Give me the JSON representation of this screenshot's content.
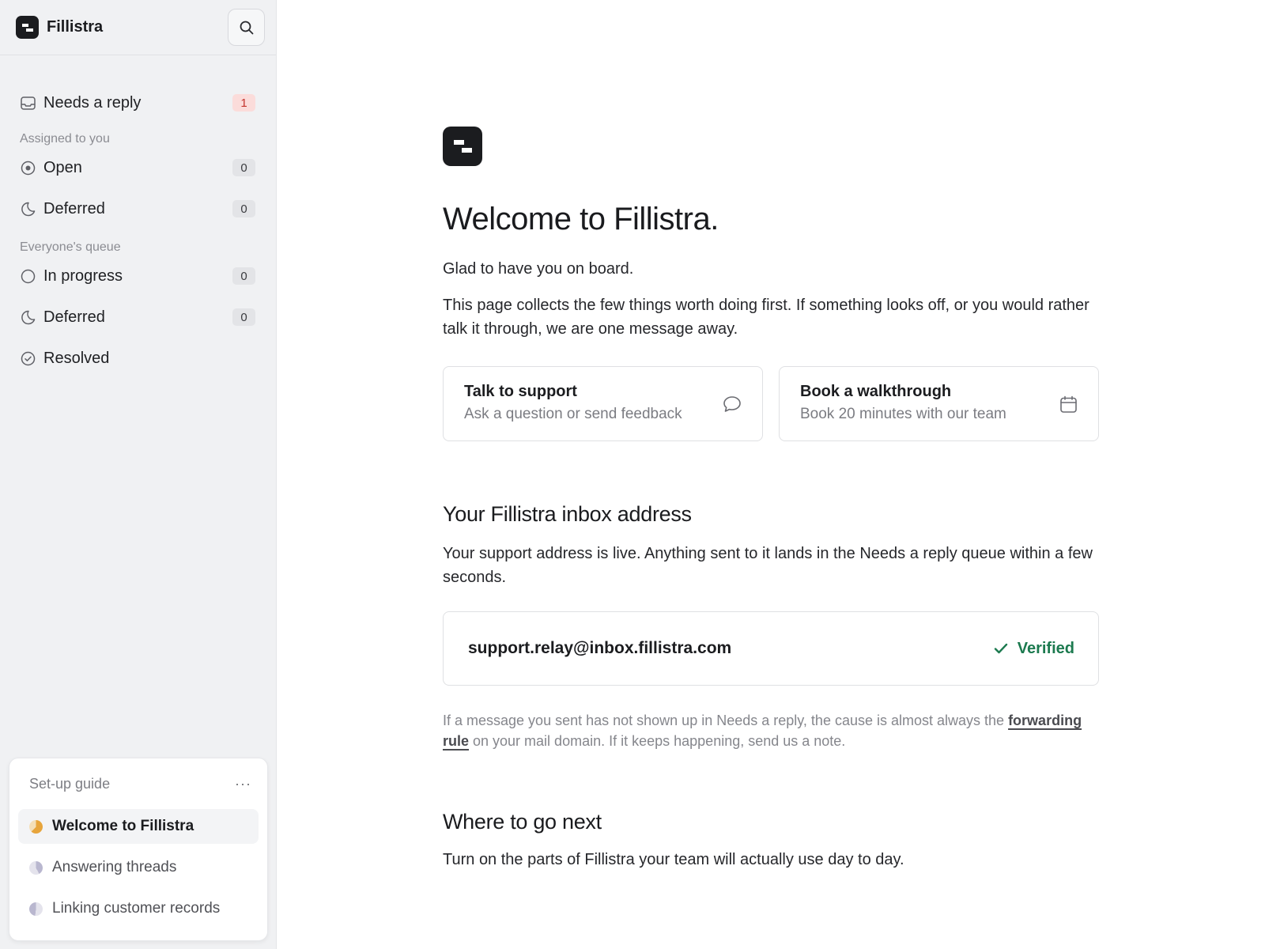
{
  "app": {
    "name": "Fillistra"
  },
  "sidebar": {
    "search_icon": "search-icon",
    "needs_reply": {
      "label": "Needs a reply",
      "count": "1",
      "icon": "inbox-icon"
    },
    "assigned": {
      "heading": "Assigned to you",
      "items": [
        {
          "label": "Open",
          "count": "0",
          "icon": "target-icon"
        },
        {
          "label": "Deferred",
          "count": "0",
          "icon": "moon-icon"
        }
      ]
    },
    "everyone": {
      "heading": "Everyone's queue",
      "items": [
        {
          "label": "In progress",
          "count": "0",
          "icon": "circle-icon"
        },
        {
          "label": "Deferred",
          "count": "0",
          "icon": "moon-icon"
        },
        {
          "label": "Resolved",
          "icon": "check-circle-icon"
        }
      ]
    },
    "guide": {
      "title": "Set-up guide",
      "more": "···",
      "items": [
        {
          "label": "Welcome to Fillistra",
          "active": true
        },
        {
          "label": "Answering threads"
        },
        {
          "label": "Linking customer records"
        }
      ]
    }
  },
  "main": {
    "title": "Welcome to Fillistra.",
    "intro_1": "Glad to have you on board.",
    "intro_2": "This page collects the few things worth doing first. If something looks off, or you would rather talk it through, we are one message away.",
    "cards": [
      {
        "title": "Talk to support",
        "subtitle": "Ask a question or send feedback",
        "icon": "chat-bubble-icon"
      },
      {
        "title": "Book a walkthrough",
        "subtitle": "Book 20 minutes with our team",
        "icon": "calendar-icon"
      }
    ],
    "inbox": {
      "heading": "Your Fillistra inbox address",
      "description": "Your support address is live. Anything sent to it lands in the Needs a reply queue within a few seconds.",
      "address": "support.relay@inbox.fillistra.com",
      "status": "Verified",
      "status_color": "#1c7a4f",
      "note_before": "If a message you sent has not shown up in Needs a reply, the cause is almost always the ",
      "note_link": "forwarding rule",
      "note_after": " on your mail domain. If it keeps happening, send us a note."
    },
    "next": {
      "heading": "Where to go next",
      "description": "Turn on the parts of Fillistra your team will actually use day to day."
    }
  }
}
